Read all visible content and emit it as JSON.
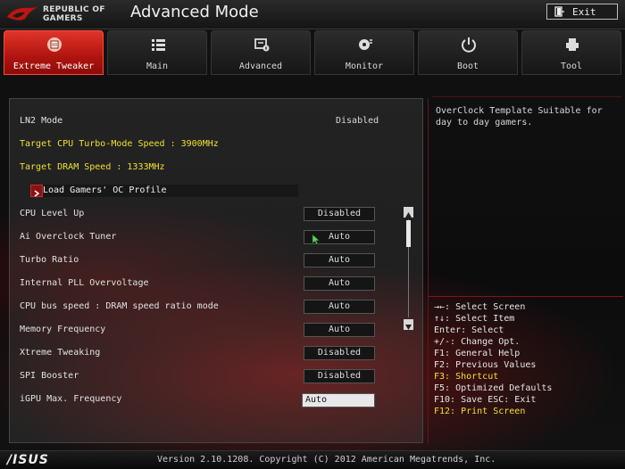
{
  "header": {
    "brand_line1": "REPUBLIC OF",
    "brand_line2": "GAMERS",
    "title": "Advanced Mode",
    "exit_label": "Exit"
  },
  "tabs": [
    {
      "label": "Extreme Tweaker",
      "icon": "memory-chip-icon",
      "active": true
    },
    {
      "label": "Main",
      "icon": "list-icon",
      "active": false
    },
    {
      "label": "Advanced",
      "icon": "advanced-settings-icon",
      "active": false
    },
    {
      "label": "Monitor",
      "icon": "monitor-gauge-icon",
      "active": false
    },
    {
      "label": "Boot",
      "icon": "power-icon",
      "active": false
    },
    {
      "label": "Tool",
      "icon": "printer-tool-icon",
      "active": false
    }
  ],
  "main": {
    "ln2_label": "LN2 Mode",
    "ln2_value": "Disabled",
    "target_cpu": "Target CPU Turbo-Mode Speed : 3900MHz",
    "target_dram": "Target DRAM Speed : 1333MHz",
    "submenu_label": "Load Gamers' OC Profile",
    "settings": [
      {
        "label": "CPU Level Up",
        "value": "Disabled"
      },
      {
        "label": "Ai Overclock Tuner",
        "value": "Auto"
      },
      {
        "label": "Turbo Ratio",
        "value": "Auto"
      },
      {
        "label": "Internal PLL Overvoltage",
        "value": "Auto"
      },
      {
        "label": "CPU bus speed : DRAM speed ratio mode",
        "value": "Auto"
      },
      {
        "label": "Memory Frequency",
        "value": "Auto"
      },
      {
        "label": "Xtreme Tweaking",
        "value": "Disabled"
      },
      {
        "label": "SPI Booster",
        "value": "Disabled"
      },
      {
        "label": "iGPU Max. Frequency",
        "value": "Auto"
      }
    ]
  },
  "help": {
    "description": "OverClock Template Suitable for day to day gamers.",
    "shortcuts": [
      "→←: Select Screen",
      "↑↓: Select Item",
      "Enter: Select",
      "+/-: Change Opt.",
      "F1: General Help",
      "F2: Previous Values",
      "F3: Shortcut",
      "F5: Optimized Defaults",
      "F10: Save  ESC: Exit",
      "F12: Print Screen"
    ]
  },
  "footer": {
    "logo": "/ISUS",
    "copyright": "Version 2.10.1208. Copyright (C) 2012 American Megatrends, Inc."
  },
  "colors": {
    "accent_red": "#c0140f",
    "highlight_yellow": "#f0e030"
  }
}
